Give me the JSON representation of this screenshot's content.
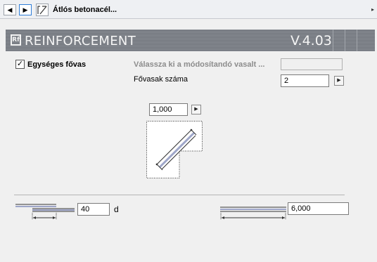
{
  "nav": {
    "prev_icon": "triangle-left-icon",
    "next_icon": "triangle-right-icon",
    "prev_glyph": "◀",
    "next_glyph": "▶",
    "object_icon": "diagonal-rebar-icon",
    "title": "Átlós betonacél...",
    "more_glyph": "▸"
  },
  "header": {
    "logo_text": "Rf",
    "title": "REINFORCEMENT",
    "version": "V.4.03",
    "colors": {
      "band": "#7b7f86",
      "text": "#f4f4f4"
    }
  },
  "main_bar": {
    "checkbox_checked": true,
    "checkbox_glyph": "✓",
    "label": "Egységes fővas"
  },
  "select_rebar": {
    "label": "Válassza ki a módosítandó vasalt ...",
    "value": ""
  },
  "bar_count": {
    "label": "Fővasak száma",
    "value": "2",
    "spin_glyph": "▶"
  },
  "bar_length": {
    "value": "1,000",
    "spin_glyph": "▶"
  },
  "lap": {
    "value": "40",
    "unit": "d"
  },
  "cover": {
    "value": "6,000"
  },
  "colors": {
    "bar": "#9ea6c9",
    "accent_border": "#2f7ed8"
  }
}
